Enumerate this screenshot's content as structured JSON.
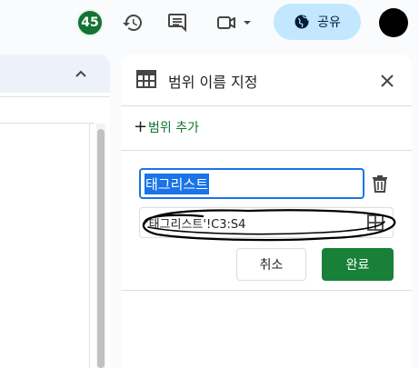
{
  "topbar": {
    "collaborator_count": "45",
    "share_label": "공유",
    "icons": [
      "history-icon",
      "comment-icon",
      "meet-video-icon",
      "chevron-down-icon",
      "globe-icon"
    ]
  },
  "named_ranges_panel": {
    "title": "범위 이름 지정",
    "add_range_label": "범위 추가",
    "name_field_value": "태그리스트",
    "range_field_value": "'태그리스트'!C3:S4",
    "cancel_label": "취소",
    "done_label": "완료"
  },
  "colors": {
    "accent_blue": "#1a73e8",
    "done_green": "#188038",
    "share_bg": "#c2e7ff",
    "avatar_green": "#137333"
  }
}
